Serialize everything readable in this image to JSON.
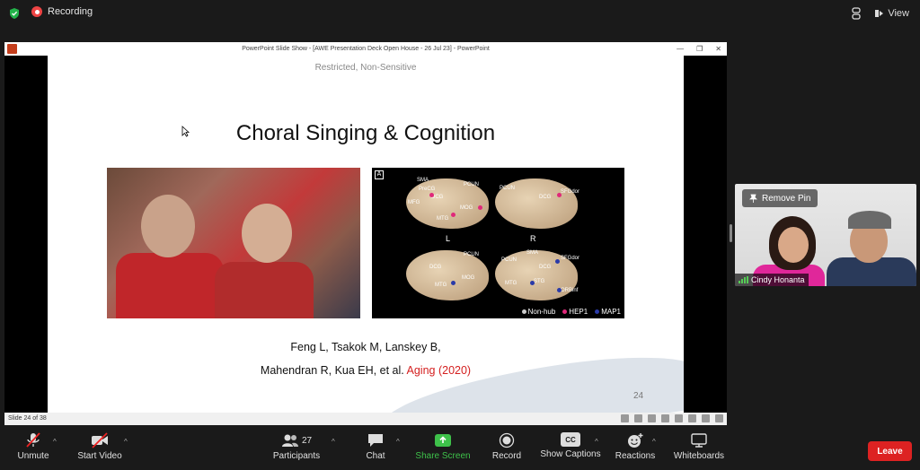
{
  "top": {
    "recording_label": "Recording",
    "view_label": "View"
  },
  "ppt": {
    "window_title": "PowerPoint Slide Show - [AWE Presentation Deck Open House - 26 Jul 23] - PowerPoint",
    "status": "Slide 24 of 38"
  },
  "slide": {
    "classification": "Restricted, Non-Sensitive",
    "title": "Choral Singing & Cognition",
    "citation_line1": "Feng L, Tsakok M, Lanskey B,",
    "citation_line2": "Mahendran R, Kua EH, et al.",
    "citation_journal": "Aging (2020)",
    "page_number": "24",
    "panel_tag": "A",
    "hemisphere_left": "L",
    "hemisphere_right": "R",
    "brain_labels_top_left": [
      "SMA",
      "PreCG",
      "MFG",
      "DCG",
      "MTG",
      "PCUN",
      "MOG"
    ],
    "brain_labels_top_right": [
      "PCUN",
      "DCG",
      "SFGdor"
    ],
    "brain_labels_bottom_left": [
      "DCG",
      "PCUN",
      "MOG",
      "MTG"
    ],
    "brain_labels_bottom_right": [
      "SMA",
      "PCUN",
      "DCG",
      "SFGdor",
      "MTG",
      "STG",
      "ORBinf"
    ],
    "legend": [
      {
        "label": "Non-hub",
        "color": "#cccccc"
      },
      {
        "label": "HEP1",
        "color": "#e0287a"
      },
      {
        "label": "MAP1",
        "color": "#2a3aa8"
      }
    ]
  },
  "participant": {
    "remove_pin_label": "Remove Pin",
    "name": "Cindy Honanta"
  },
  "toolbar": {
    "unmute": "Unmute",
    "start_video": "Start Video",
    "participants": "Participants",
    "participants_count": "27",
    "chat": "Chat",
    "share_screen": "Share Screen",
    "record": "Record",
    "show_captions": "Show Captions",
    "cc_badge": "CC",
    "reactions": "Reactions",
    "whiteboards": "Whiteboards",
    "leave": "Leave"
  },
  "colors": {
    "accent_green": "#3ec14a",
    "leave_red": "#dd2222",
    "citation_red": "#d42020"
  }
}
